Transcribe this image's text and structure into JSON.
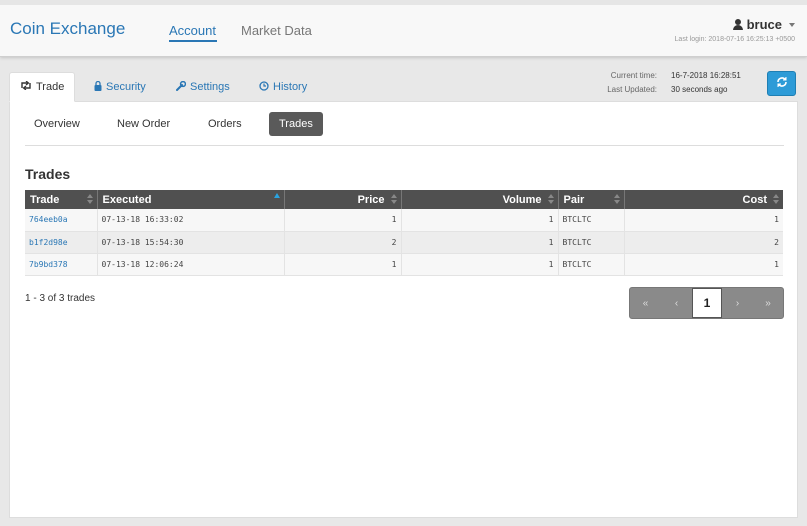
{
  "app": {
    "brand": "Coin Exchange"
  },
  "nav": {
    "account": "Account",
    "market_data": "Market Data"
  },
  "user": {
    "name": "bruce",
    "last_login": "Last login: 2018-07-16 16:25:13 +0500"
  },
  "tabs": [
    {
      "label": "Trade",
      "icon": "retweet-icon"
    },
    {
      "label": "Security",
      "icon": "lock-icon"
    },
    {
      "label": "Settings",
      "icon": "wrench-icon"
    },
    {
      "label": "History",
      "icon": "clock-icon"
    }
  ],
  "status": {
    "current_time_label": "Current time:",
    "current_time": "16-7-2018 16:28:51",
    "last_updated_label": "Last Updated:",
    "last_updated": "30 seconds ago"
  },
  "subnav": [
    "Overview",
    "New Order",
    "Orders",
    "Trades"
  ],
  "section_title": "Trades",
  "table": {
    "headers": [
      "Trade",
      "Executed",
      "Price",
      "Volume",
      "Pair",
      "Cost"
    ],
    "rows": [
      [
        "764eeb0a",
        "07-13-18 16:33:02",
        "1",
        "1",
        "BTCLTC",
        "1"
      ],
      [
        "b1f2d98e",
        "07-13-18 15:54:30",
        "2",
        "1",
        "BTCLTC",
        "2"
      ],
      [
        "7b9bd378",
        "07-13-18 12:06:24",
        "1",
        "1",
        "BTCLTC",
        "1"
      ]
    ]
  },
  "summary": "1 - 3 of 3 trades",
  "pager": {
    "first": "«",
    "prev": "‹",
    "current": "1",
    "next": "›",
    "last": "»"
  },
  "colors": {
    "accent": "#2a77b5",
    "refresh": "#2d9bd7",
    "header_dark": "#505050"
  }
}
